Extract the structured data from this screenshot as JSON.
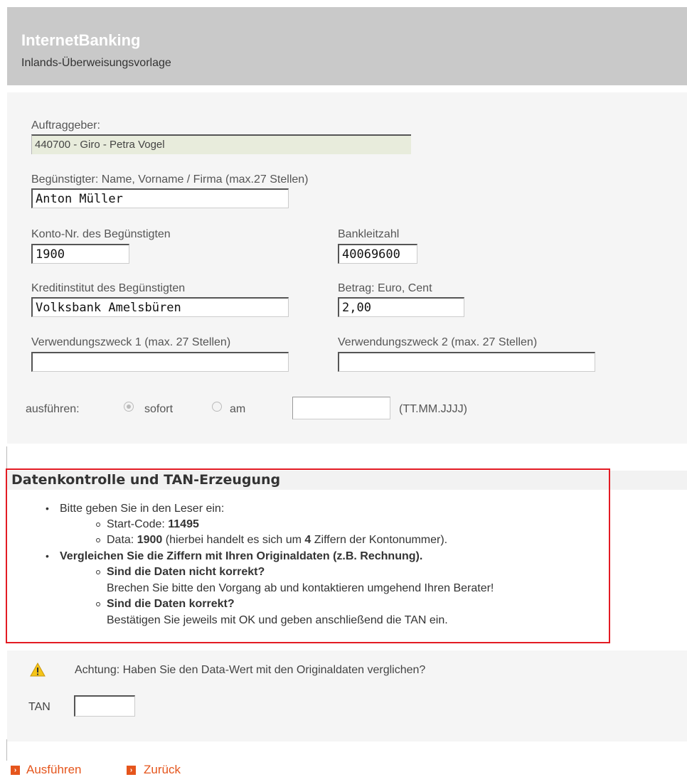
{
  "header": {
    "app_title": "InternetBanking",
    "page_title": "Inlands-Überweisungsvorlage"
  },
  "form": {
    "auftraggeber_label": "Auftraggeber:",
    "auftraggeber_value": "440700 - Giro - Petra Vogel",
    "beguenstigter_label": "Begünstigter: Name, Vorname / Firma (max.27 Stellen)",
    "beguenstigter_value": "Anton Müller",
    "konto_label": "Konto-Nr. des Begünstigten",
    "konto_value": "1900",
    "blz_label": "Bankleitzahl",
    "blz_value": "40069600",
    "kreditinstitut_label": "Kreditinstitut des Begünstigten",
    "kreditinstitut_value": "Volksbank Amelsbüren",
    "betrag_label": "Betrag: Euro, Cent",
    "betrag_value": "2,00",
    "zweck1_label": "Verwendungszweck 1 (max. 27 Stellen)",
    "zweck1_value": "",
    "zweck2_label": "Verwendungszweck 2 (max. 27 Stellen)",
    "zweck2_value": "",
    "execute_label": "ausführen:",
    "option_sofort": "sofort",
    "option_am": "am",
    "selected_option": "sofort",
    "date_value": "",
    "date_hint": "(TT.MM.JJJJ)"
  },
  "tan_section": {
    "heading": "Datenkontrolle und TAN-Erzeugung",
    "item1": "Bitte geben Sie in den Leser ein:",
    "start_code_label": "Start-Code:",
    "start_code_value": "11495",
    "data_label": "Data:",
    "data_value": "1900",
    "data_note_pre": "(hierbei handelt es sich um",
    "data_note_count": "4",
    "data_note_post": "Ziffern der Kontonummer).",
    "item2": "Vergleichen Sie die Ziffern mit Ihren Originaldaten (z.B. Rechnung).",
    "not_correct_q": "Sind die Daten nicht korrekt?",
    "not_correct_a": "Brechen Sie bitte den Vorgang ab und kontaktieren umgehend Ihren Berater!",
    "correct_q": "Sind die Daten korrekt?",
    "correct_a": "Bestätigen Sie jeweils mit OK und geben anschließend die TAN ein."
  },
  "confirm": {
    "warning_text": "Achtung: Haben Sie den Data-Wert mit den Originaldaten verglichen?",
    "tan_label": "TAN",
    "tan_value": ""
  },
  "actions": {
    "execute": "Ausführen",
    "back": "Zurück"
  },
  "colors": {
    "header_bg": "#c9c9c9",
    "accent": "#e5551c",
    "highlight_border": "#e31b23",
    "readonly_bg": "#e8ecdc"
  },
  "icons": {
    "warning": "warning-triangle-icon",
    "link_arrow": "arrow-right-icon"
  }
}
